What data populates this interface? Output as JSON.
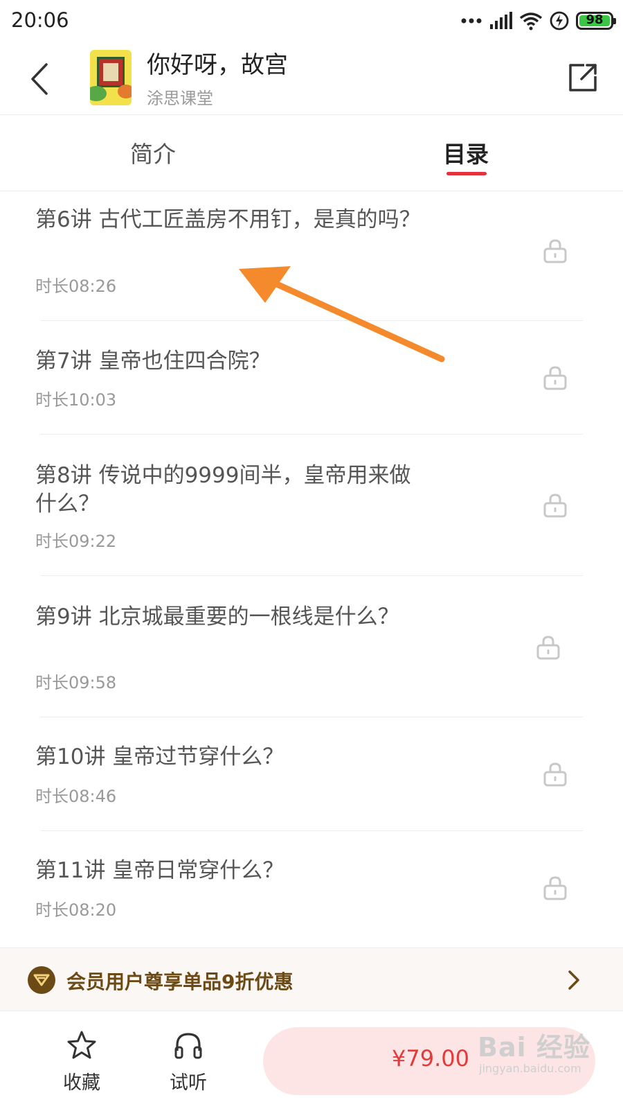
{
  "status_bar": {
    "time": "20:06",
    "battery_level": "98",
    "icons": [
      "dots-icon",
      "signal-icon",
      "wifi-icon",
      "charging-icon",
      "battery-icon"
    ]
  },
  "header": {
    "title": "你好呀，故宫",
    "subtitle": "涂思课堂",
    "back_icon": "chevron-left-icon",
    "share_icon": "share-icon"
  },
  "tabs": [
    {
      "label": "简介",
      "active": false
    },
    {
      "label": "目录",
      "active": true
    }
  ],
  "lessons": [
    {
      "title": "第6讲 古代工匠盖房不用钉，是真的吗？",
      "duration": "时长08:26",
      "locked": true
    },
    {
      "title": "第7讲 皇帝也住四合院？",
      "duration": "时长10:03",
      "locked": true
    },
    {
      "title": "第8讲 传说中的9999间半，皇帝用来做什么？",
      "duration": "时长09:22",
      "locked": true
    },
    {
      "title": "第9讲 北京城最重要的一根线是什么？",
      "duration": "时长09:58",
      "locked": true
    },
    {
      "title": "第10讲 皇帝过节穿什么？",
      "duration": "时长08:46",
      "locked": true
    },
    {
      "title": "第11讲 皇帝日常穿什么？",
      "duration": "时长08:20",
      "locked": true
    }
  ],
  "member_banner": {
    "text": "会员用户尊享单品9折优惠"
  },
  "bottom_bar": {
    "favorite_label": "收藏",
    "listen_label": "试听",
    "price": "¥79.00"
  },
  "watermark": {
    "logo": "Bai 经验",
    "url": "jingyan.baidu.com"
  },
  "colors": {
    "accent": "#e5313b",
    "price": "#e43a3a",
    "price_button_bg": "#fde5e5",
    "member_brown": "#6b4a16",
    "annotation_arrow": "#f58a2c"
  }
}
